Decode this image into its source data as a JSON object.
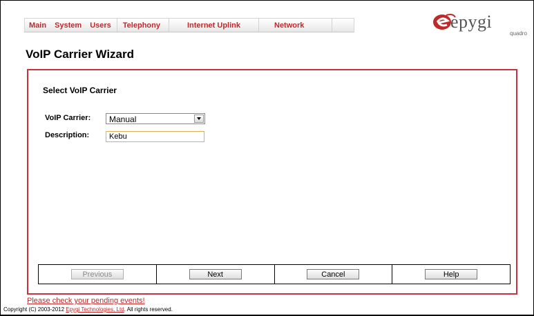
{
  "nav": {
    "items": [
      {
        "label": "Main"
      },
      {
        "label": "System"
      },
      {
        "label": "Users"
      },
      {
        "label": "Telephony"
      },
      {
        "label": "Internet Uplink"
      },
      {
        "label": "Network"
      }
    ]
  },
  "logo": {
    "brand": "epygi",
    "sub": "quadro"
  },
  "page": {
    "title": "VoIP Carrier Wizard"
  },
  "form": {
    "section_title": "Select VoIP Carrier",
    "carrier_label": "VoIP Carrier:",
    "carrier_value": "Manual",
    "description_label": "Description:",
    "description_value": "Kebu"
  },
  "buttons": {
    "previous": "Previous",
    "next": "Next",
    "cancel": "Cancel",
    "help": "Help"
  },
  "footer": {
    "pending_link": "Please check your pending events!",
    "copyright_prefix": "Copyright (C) 2003-2012 ",
    "copyright_company": "Epygi Technologies, Ltd",
    "copyright_suffix": ". All rights reserved."
  },
  "colors": {
    "accent": "#c0282a",
    "panel_border": "#c8323c",
    "input_focus_border": "#e0b050"
  },
  "icons": {
    "logo": "epygi-e-logo-icon",
    "dropdown": "dropdown-arrow-icon"
  }
}
